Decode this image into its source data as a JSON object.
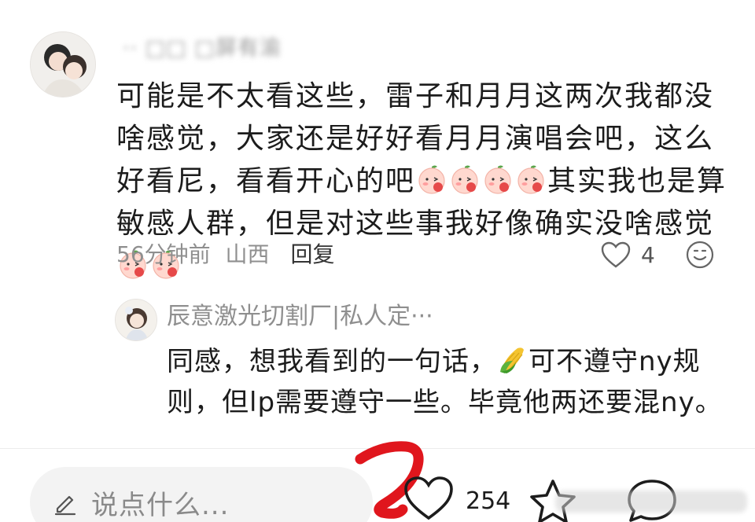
{
  "comment": {
    "username": "·· □□ □屏有渝",
    "text_segments": [
      "可能是不太看这些，雷子和月月这两次我都没啥感觉，大家还是好好看月月演唱会吧，这么好看尼，看看开心的吧",
      "其实我也是算敏感人群，但是对这些事我好像确实没啥感觉"
    ],
    "time": "56分钟前",
    "location": "山西",
    "reply_label": "回复",
    "like_count": "4",
    "emoji_icon": "peach-blush-emoji"
  },
  "reply": {
    "username": "辰意激光切割厂|私人定···",
    "text_before_emoji": "同感，想我看到的一句话，",
    "text_after_emoji": "可不遵守ny规则，但lp需要遵守一些。毕竟他两还要混ny。",
    "emoji_icon": "corn-emoji"
  },
  "bottom_bar": {
    "input_placeholder": "说点什么...",
    "like_count": "254"
  },
  "colors": {
    "text_primary": "#1c1c1c",
    "text_secondary": "#8f8f8f",
    "input_bg": "#f3f3f3",
    "annotation_red": "#e0161d"
  }
}
